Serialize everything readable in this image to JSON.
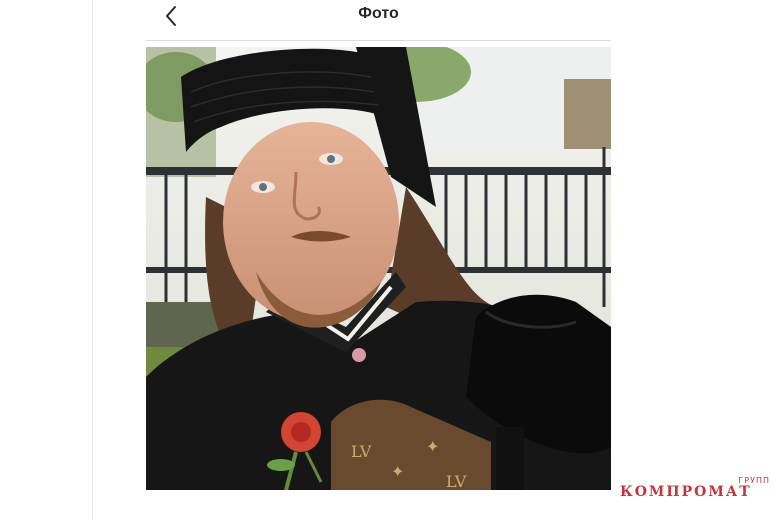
{
  "header": {
    "title": "Фото",
    "back_icon": "chevron-left-icon"
  },
  "photo": {
    "subject": "photo"
  },
  "watermark": {
    "main": "КОМПРОМАТ",
    "small": "ГРУПП",
    "color": "#c8333a"
  }
}
